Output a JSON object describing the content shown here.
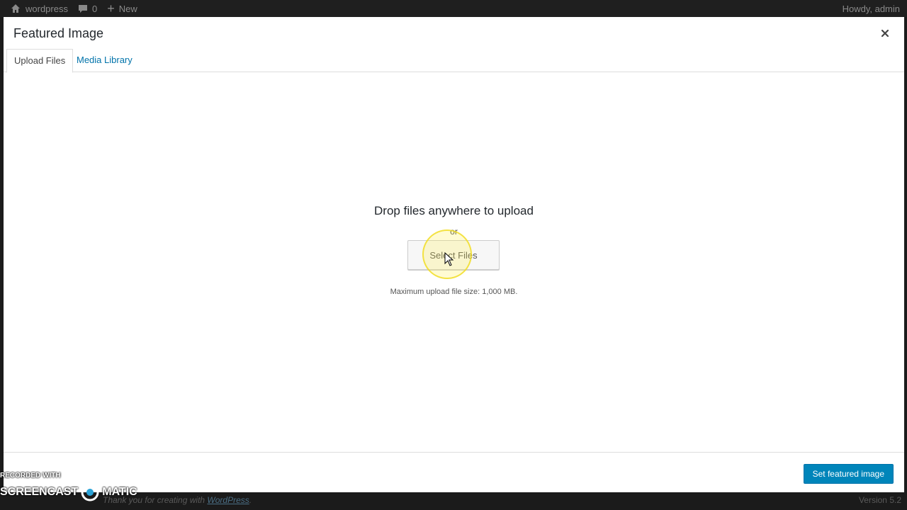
{
  "adminbar": {
    "site_name": "wordpress",
    "comments_count": "0",
    "new_label": "New",
    "greeting": "Howdy, admin"
  },
  "modal": {
    "title": "Featured Image",
    "close_icon": "close-icon",
    "tabs": [
      {
        "label": "Upload Files",
        "active": true
      },
      {
        "label": "Media Library",
        "active": false
      }
    ]
  },
  "uploader": {
    "drop_text": "Drop files anywhere to upload",
    "or_text": "or",
    "select_button": "Select Files",
    "max_size": "Maximum upload file size: 1,000 MB."
  },
  "toolbar": {
    "primary_button": "Set featured image"
  },
  "footer": {
    "thanks_prefix": "Thank you for creating with ",
    "thanks_link": "WordPress",
    "thanks_suffix": ".",
    "version": "Version 5.2"
  },
  "watermark": {
    "line1": "RECORDED WITH",
    "line2a": "SCREENCAST",
    "line2b": "MATIC"
  },
  "colors": {
    "primary": "#0085ba",
    "link": "#0073aa",
    "cursor_highlight": "#f5e52a"
  }
}
